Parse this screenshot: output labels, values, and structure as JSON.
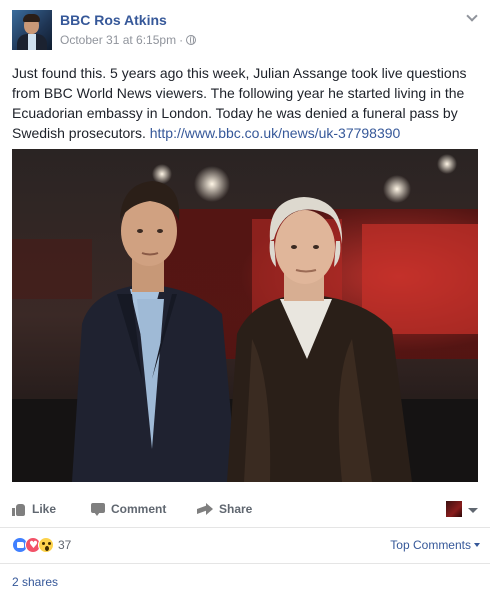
{
  "post": {
    "page_name": "BBC Ros Atkins",
    "timestamp": "October 31 at 6:15pm",
    "separator": "·",
    "privacy_icon": "globe-icon",
    "text": "Just found this. 5 years ago this week, Julian Assange took live questions from BBC World News viewers. The following year he started living in the Ecuadorian embassy in London. Today he was denied a funeral pass by Swedish prosecutors. ",
    "link": "http://www.bbc.co.uk/news/uk-37798390"
  },
  "actions": {
    "like_label": "Like",
    "comment_label": "Comment",
    "share_label": "Share"
  },
  "reactions": {
    "types": [
      "like",
      "love",
      "wow"
    ],
    "count": "37"
  },
  "comments": {
    "sort_label": "Top Comments"
  },
  "shares": {
    "label": "2 shares"
  },
  "colors": {
    "link": "#365899",
    "meta": "#90949c",
    "action": "#606770"
  }
}
